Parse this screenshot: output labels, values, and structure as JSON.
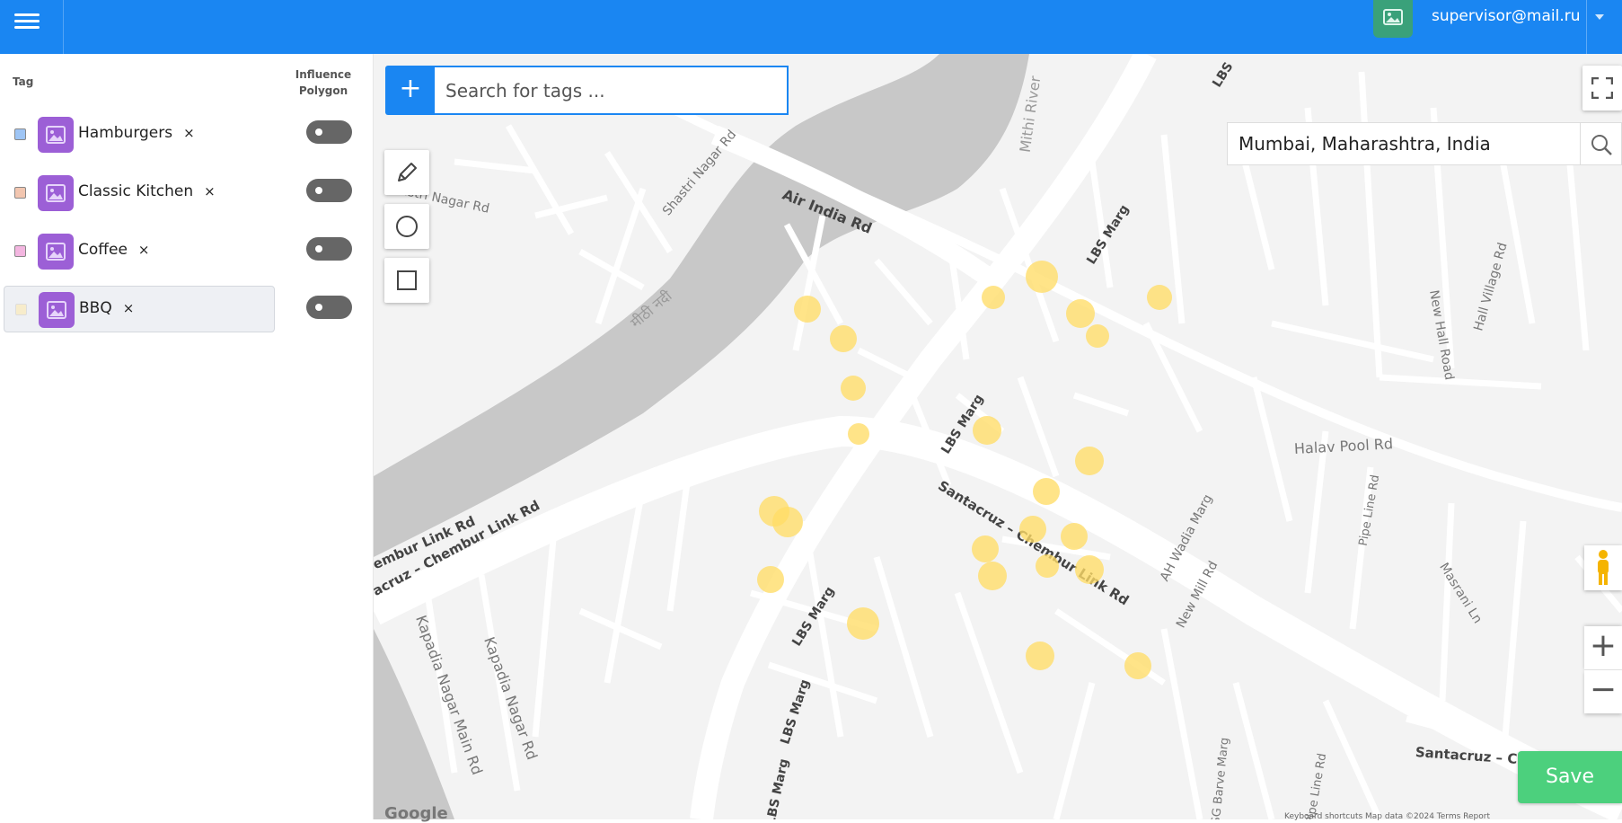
{
  "header": {
    "user_email": "supervisor@mail.ru",
    "menu_icon": "hamburger-menu-icon",
    "avatar_icon": "image-icon"
  },
  "sidebar": {
    "column_tag": "Tag",
    "column_influence": "Influence Polygon",
    "tags": [
      {
        "label": "Hamburgers",
        "remove": "×",
        "color": "#9ec5f5",
        "selected": false,
        "influence_on": false
      },
      {
        "label": "Classic Kitchen",
        "remove": "×",
        "color": "#f2c6b0",
        "selected": false,
        "influence_on": false
      },
      {
        "label": "Coffee",
        "remove": "×",
        "color": "#f3b6e0",
        "selected": false,
        "influence_on": false
      },
      {
        "label": "BBQ",
        "remove": "×",
        "color": "#f7eccb",
        "selected": true,
        "influence_on": false
      }
    ]
  },
  "map": {
    "add_tag_label": "+",
    "search_placeholder": "Search for tags ...",
    "location_value": "Mumbai, Maharashtra, India",
    "zoom_in_label": "+",
    "zoom_out_label": "−",
    "save_label": "Save",
    "google_logo": "Google",
    "attribution": "Keyboard shortcuts   Map data ©2024   Terms   Report",
    "marker_color": "#ffdd66",
    "labels": {
      "mithi_river": "Mithi River",
      "air_india_rd": "Air India Rd",
      "shastri_nagar_rd_1": "Shastri Nagar Rd",
      "shastri_nagar_rd_2": "astri Nagar Rd",
      "mithi_nadi": "मीठी नदी",
      "lbs_marg_1": "LBS Marg",
      "lbs_marg_2": "LBS Marg",
      "lbs_marg_3": "LBS Marg",
      "lbs_marg_4": "LBS Marg",
      "lbs_marg_5": "LBS Marg",
      "santacruz_chembur_1": "Santacruz – Chembur Link Rd",
      "santacruz_chembur_2": "acruz – Chembur Link Rd",
      "chembur_link_rd": "embur Link Rd",
      "santacruz_3": "Santacruz – Ch",
      "kapadia_main": "Kapadia Nagar Main Rd",
      "kapadia_rd": "Kapadia Nagar Rd",
      "halav_pool_rd": "Halav Pool Rd",
      "pipe_line_rd_1": "Pipe Line Rd",
      "pipe_line_rd_2": "Pipe Line Rd",
      "ah_wadia_marg": "AH Wadia Marg",
      "new_mill_rd": "New Mill Rd",
      "masrani_ln": "Masrani Ln",
      "new_hall_road": "New Hall Road",
      "hall_village_rd": "Hall Village Rd",
      "sg_barve_marg": "SG Barve Marg",
      "lbs_top": "LBS"
    }
  }
}
